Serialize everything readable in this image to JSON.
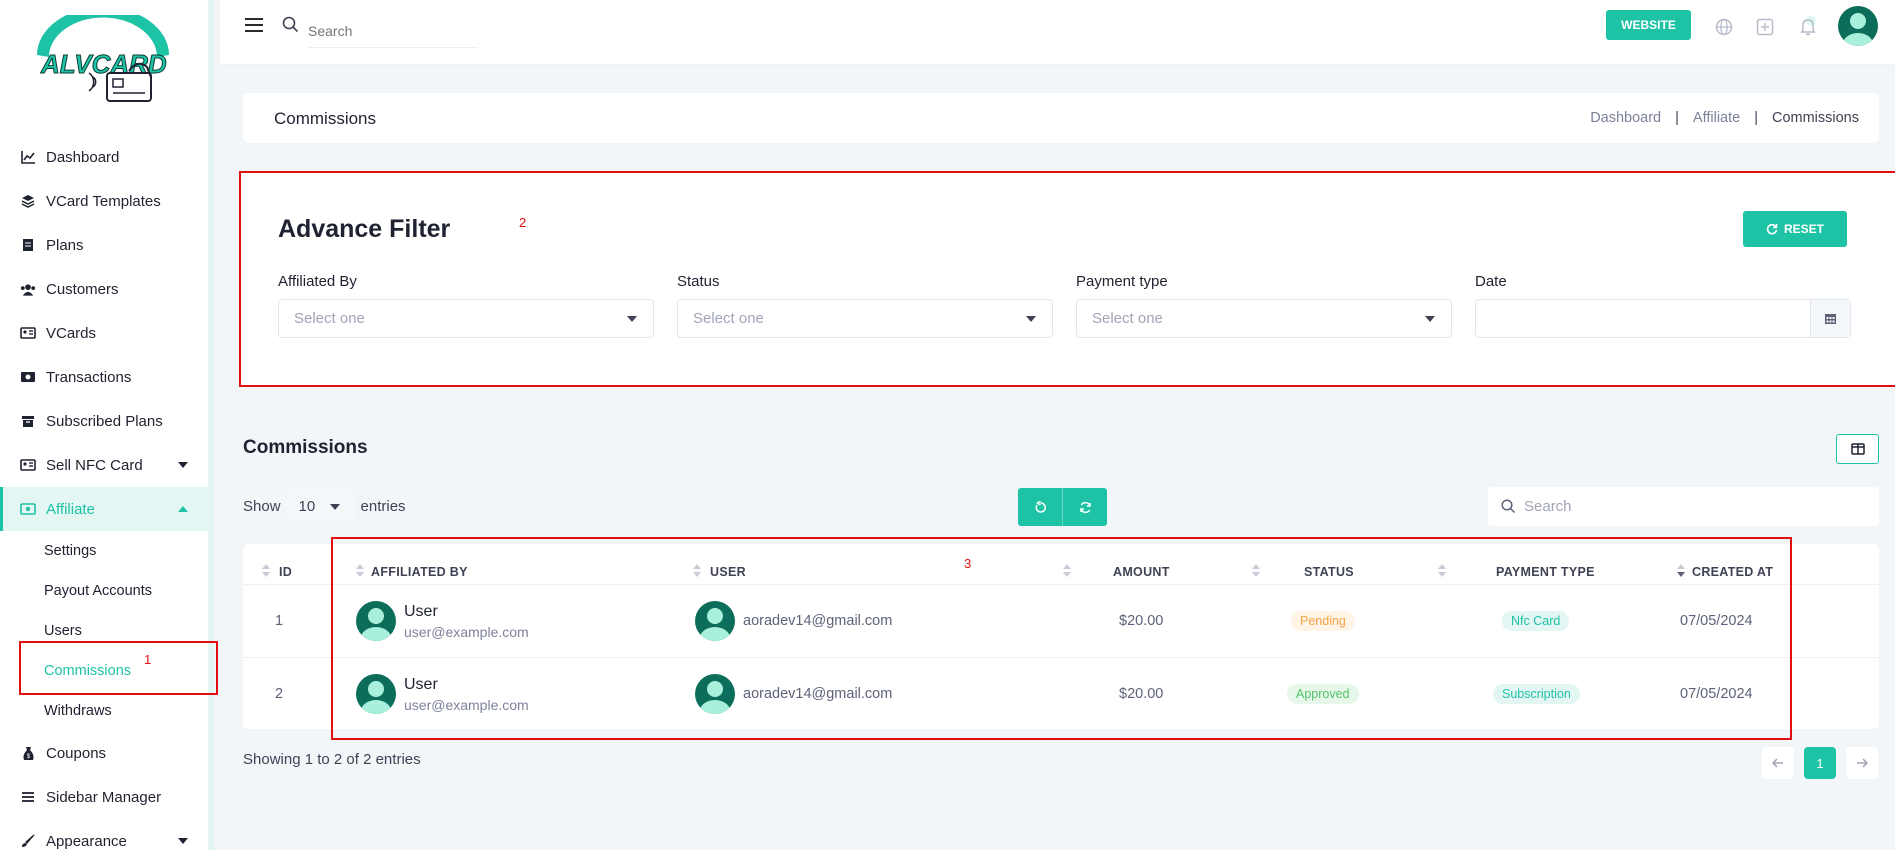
{
  "brand": {
    "name": "ALVCARD",
    "accent": "#1ec3a6",
    "dark": "#0c6e5a"
  },
  "sidebar": {
    "items": [
      {
        "label": "Dashboard",
        "icon": "chart-line-icon"
      },
      {
        "label": "VCard Templates",
        "icon": "layers-icon"
      },
      {
        "label": "Plans",
        "icon": "document-icon"
      },
      {
        "label": "Customers",
        "icon": "users-icon"
      },
      {
        "label": "VCards",
        "icon": "id-card-icon"
      },
      {
        "label": "Transactions",
        "icon": "money-icon"
      },
      {
        "label": "Subscribed Plans",
        "icon": "archive-icon"
      },
      {
        "label": "Sell NFC Card",
        "icon": "id-card-icon"
      },
      {
        "label": "Affiliate",
        "icon": "cash-icon"
      },
      {
        "label": "Coupons",
        "icon": "money-bag-icon"
      },
      {
        "label": "Sidebar Manager",
        "icon": "list-icon"
      },
      {
        "label": "Appearance",
        "icon": "brush-icon"
      }
    ],
    "affiliate_sub": [
      "Settings",
      "Payout Accounts",
      "Users",
      "Commissions",
      "Withdraws"
    ],
    "annotation": "1"
  },
  "header": {
    "search_placeholder": "Search",
    "website_label": "WEBSITE"
  },
  "page": {
    "title": "Commissions",
    "breadcrumb": [
      "Dashboard",
      "Affiliate",
      "Commissions"
    ],
    "separator": "|"
  },
  "filter": {
    "title": "Advance Filter",
    "annotation": "2",
    "reset_label": "RESET",
    "fields": [
      {
        "label": "Affiliated By",
        "placeholder": "Select one"
      },
      {
        "label": "Status",
        "placeholder": "Select one"
      },
      {
        "label": "Payment type",
        "placeholder": "Select one"
      },
      {
        "label": "Date",
        "placeholder": ""
      }
    ]
  },
  "table": {
    "title": "Commissions",
    "show_label": "Show",
    "entries_value": "10",
    "entries_label": "entries",
    "search_placeholder": "Search",
    "annotation": "3",
    "columns": [
      "ID",
      "AFFILIATED BY",
      "USER",
      "AMOUNT",
      "STATUS",
      "PAYMENT TYPE",
      "CREATED AT"
    ],
    "rows": [
      {
        "id": "1",
        "aff_name": "User",
        "aff_email": "user@example.com",
        "user_email": "aoradev14@gmail.com",
        "amount": "$20.00",
        "status": "Pending",
        "status_kind": "pending",
        "payment_type": "Nfc Card",
        "created_at": "07/05/2024"
      },
      {
        "id": "2",
        "aff_name": "User",
        "aff_email": "user@example.com",
        "user_email": "aoradev14@gmail.com",
        "amount": "$20.00",
        "status": "Approved",
        "status_kind": "approved",
        "payment_type": "Subscription",
        "created_at": "07/05/2024"
      }
    ],
    "footer": "Showing 1 to 2 of 2 entries",
    "current_page": "1"
  }
}
